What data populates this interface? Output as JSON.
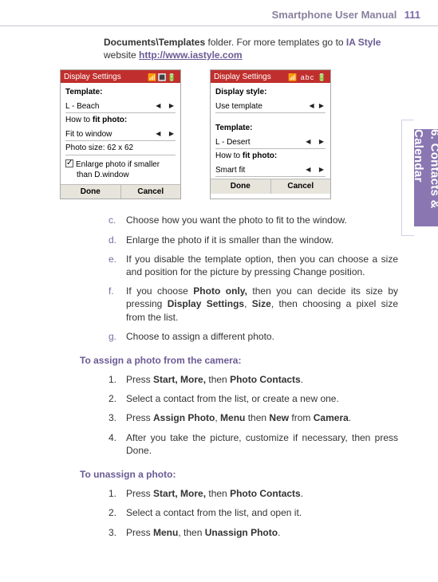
{
  "header": {
    "title": "Smartphone User Manual",
    "page": "111"
  },
  "sideTab": "6. Contacts & Calendar",
  "intro": {
    "prefix": "Documents\\Templates",
    "rest": " folder. For more templates go to ",
    "brand": "IA Style",
    "mid": " website ",
    "url": "http://www.iastyle.com"
  },
  "mockLeft": {
    "title": "Display Settings",
    "tmplLabel": "Template:",
    "tmplVal": "L - Beach",
    "howLabelA": "How to ",
    "howLabelB": "fit photo:",
    "howVal": "Fit to window",
    "sizeLabel": "Photo size:",
    "sizeVal": "62 x 62",
    "checkA": "Enlarge photo if smaller",
    "checkB": "than D.window",
    "done": "Done",
    "cancel": "Cancel"
  },
  "mockRight": {
    "title": "Display Settings",
    "styleLabel": "Display style:",
    "styleVal": "Use template",
    "tmplLabel": "Template:",
    "tmplVal": "L - Desert",
    "howLabelA": "How to ",
    "howLabelB": "fit photo:",
    "howVal": "Smart fit",
    "done": "Done",
    "cancel": "Cancel"
  },
  "letters": {
    "c": "Choose how you want the photo to fit to the window.",
    "d": "Enlarge the photo if it is smaller than the window.",
    "e": "If you disable the template option, then you can choose a size and position for the picture by pressing Change position.",
    "f_pre": "If you choose ",
    "f_b1": "Photo only,",
    "f_mid1": " then you can decide its size by pressing ",
    "f_b2": "Display Settings",
    "f_mid2": ", ",
    "f_b3": "Size",
    "f_post": ", then choosing a pixel size from the list.",
    "g": "Choose to assign a different photo."
  },
  "sec1": {
    "title": "To assign a photo from the camera:",
    "s1a": "Press ",
    "s1b": "Start, More,",
    "s1c": " then ",
    "s1d": "Photo Contacts",
    "s1e": ".",
    "s2": "Select a contact from the list, or create a new one.",
    "s3a": "Press ",
    "s3b": "Assign Photo",
    "s3c": ", ",
    "s3d": "Menu",
    "s3e": " then ",
    "s3f": "New",
    "s3g": " from ",
    "s3h": "Camera",
    "s3i": ".",
    "s4": "After you take the picture, customize if necessary, then press Done."
  },
  "sec2": {
    "title": "To unassign a photo:",
    "s1a": "Press ",
    "s1b": "Start, More,",
    "s1c": " then ",
    "s1d": "Photo Contacts",
    "s1e": ".",
    "s2": "Select a contact from the list, and open it.",
    "s3a": "Press ",
    "s3b": "Menu",
    "s3c": ", then ",
    "s3d": "Unassign Photo",
    "s3e": "."
  }
}
